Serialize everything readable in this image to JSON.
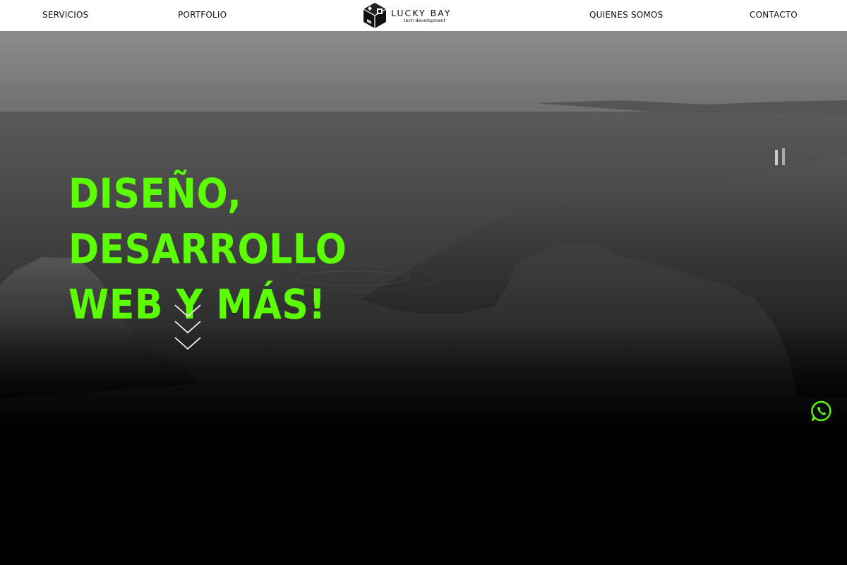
{
  "nav": {
    "services": "SERVICIOS",
    "portfolio": "PORTFOLIO",
    "about": "QUIENES SOMOS",
    "contact": "CONTACTO",
    "logo_name": "LUCKY BAY",
    "logo_tagline": "tech development"
  },
  "hero": {
    "headline_lines": [
      "DISEÑO,",
      "DESARROLLO",
      "WEB Y MÁS!"
    ]
  },
  "colors": {
    "accent": "#5cff00",
    "nav_bg": "#ffffff",
    "page_bg": "#000000"
  },
  "icons": {
    "scroll": "chevron-down-triple-icon",
    "whatsapp": "whatsapp-icon",
    "logo": "cube-logo-icon"
  }
}
